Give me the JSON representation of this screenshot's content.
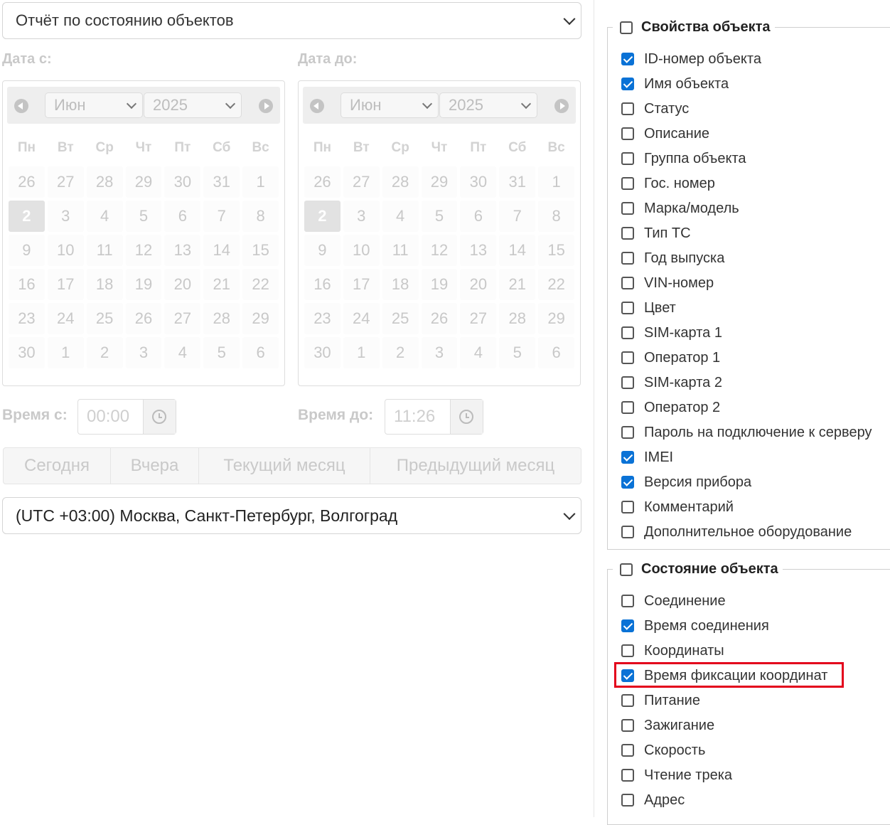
{
  "report_select": {
    "value": "Отчёт по состоянию объектов"
  },
  "date_from": {
    "label": "Дата с:",
    "month": "Июн",
    "year": "2025",
    "weekdays": [
      "Пн",
      "Вт",
      "Ср",
      "Чт",
      "Пт",
      "Сб",
      "Вс"
    ],
    "weeks": [
      [
        "26",
        "27",
        "28",
        "29",
        "30",
        "31",
        "1"
      ],
      [
        "2",
        "3",
        "4",
        "5",
        "6",
        "7",
        "8"
      ],
      [
        "9",
        "10",
        "11",
        "12",
        "13",
        "14",
        "15"
      ],
      [
        "16",
        "17",
        "18",
        "19",
        "20",
        "21",
        "22"
      ],
      [
        "23",
        "24",
        "25",
        "26",
        "27",
        "28",
        "29"
      ],
      [
        "30",
        "1",
        "2",
        "3",
        "4",
        "5",
        "6"
      ]
    ],
    "selected_day": "2"
  },
  "date_to": {
    "label": "Дата до:",
    "month": "Июн",
    "year": "2025",
    "weekdays": [
      "Пн",
      "Вт",
      "Ср",
      "Чт",
      "Пт",
      "Сб",
      "Вс"
    ],
    "weeks": [
      [
        "26",
        "27",
        "28",
        "29",
        "30",
        "31",
        "1"
      ],
      [
        "2",
        "3",
        "4",
        "5",
        "6",
        "7",
        "8"
      ],
      [
        "9",
        "10",
        "11",
        "12",
        "13",
        "14",
        "15"
      ],
      [
        "16",
        "17",
        "18",
        "19",
        "20",
        "21",
        "22"
      ],
      [
        "23",
        "24",
        "25",
        "26",
        "27",
        "28",
        "29"
      ],
      [
        "30",
        "1",
        "2",
        "3",
        "4",
        "5",
        "6"
      ]
    ],
    "selected_day": "2"
  },
  "time_from": {
    "label": "Время с:",
    "value": "00:00"
  },
  "time_to": {
    "label": "Время до:",
    "value": "11:26"
  },
  "quick_ranges": [
    "Сегодня",
    "Вчера",
    "Текущий месяц",
    "Предыдущий месяц"
  ],
  "timezone_select": {
    "value": "(UTC +03:00) Москва, Санкт-Петербург, Волгоград"
  },
  "object_properties": {
    "title": "Свойства объекта",
    "checked": false,
    "items": [
      {
        "label": "ID-номер объекта",
        "checked": true
      },
      {
        "label": "Имя объекта",
        "checked": true
      },
      {
        "label": "Статус",
        "checked": false
      },
      {
        "label": "Описание",
        "checked": false
      },
      {
        "label": "Группа объекта",
        "checked": false
      },
      {
        "label": "Гос. номер",
        "checked": false
      },
      {
        "label": "Марка/модель",
        "checked": false
      },
      {
        "label": "Тип ТС",
        "checked": false
      },
      {
        "label": "Год выпуска",
        "checked": false
      },
      {
        "label": "VIN-номер",
        "checked": false
      },
      {
        "label": "Цвет",
        "checked": false
      },
      {
        "label": "SIM-карта 1",
        "checked": false
      },
      {
        "label": "Оператор 1",
        "checked": false
      },
      {
        "label": "SIM-карта 2",
        "checked": false
      },
      {
        "label": "Оператор 2",
        "checked": false
      },
      {
        "label": "Пароль на подключение к серверу",
        "checked": false
      },
      {
        "label": "IMEI",
        "checked": true
      },
      {
        "label": "Версия прибора",
        "checked": true
      },
      {
        "label": "Комментарий",
        "checked": false
      },
      {
        "label": "Дополнительное оборудование",
        "checked": false
      }
    ]
  },
  "object_state": {
    "title": "Состояние объекта",
    "checked": false,
    "items": [
      {
        "label": "Соединение",
        "checked": false
      },
      {
        "label": "Время соединения",
        "checked": true
      },
      {
        "label": "Координаты",
        "checked": false
      },
      {
        "label": "Время фиксации координат",
        "checked": true
      },
      {
        "label": "Питание",
        "checked": false
      },
      {
        "label": "Зажигание",
        "checked": false
      },
      {
        "label": "Скорость",
        "checked": false
      },
      {
        "label": "Чтение трека",
        "checked": false
      },
      {
        "label": "Адрес",
        "checked": false
      }
    ]
  },
  "colors": {
    "accent": "#0a72d6",
    "highlight": "#e3001b"
  }
}
